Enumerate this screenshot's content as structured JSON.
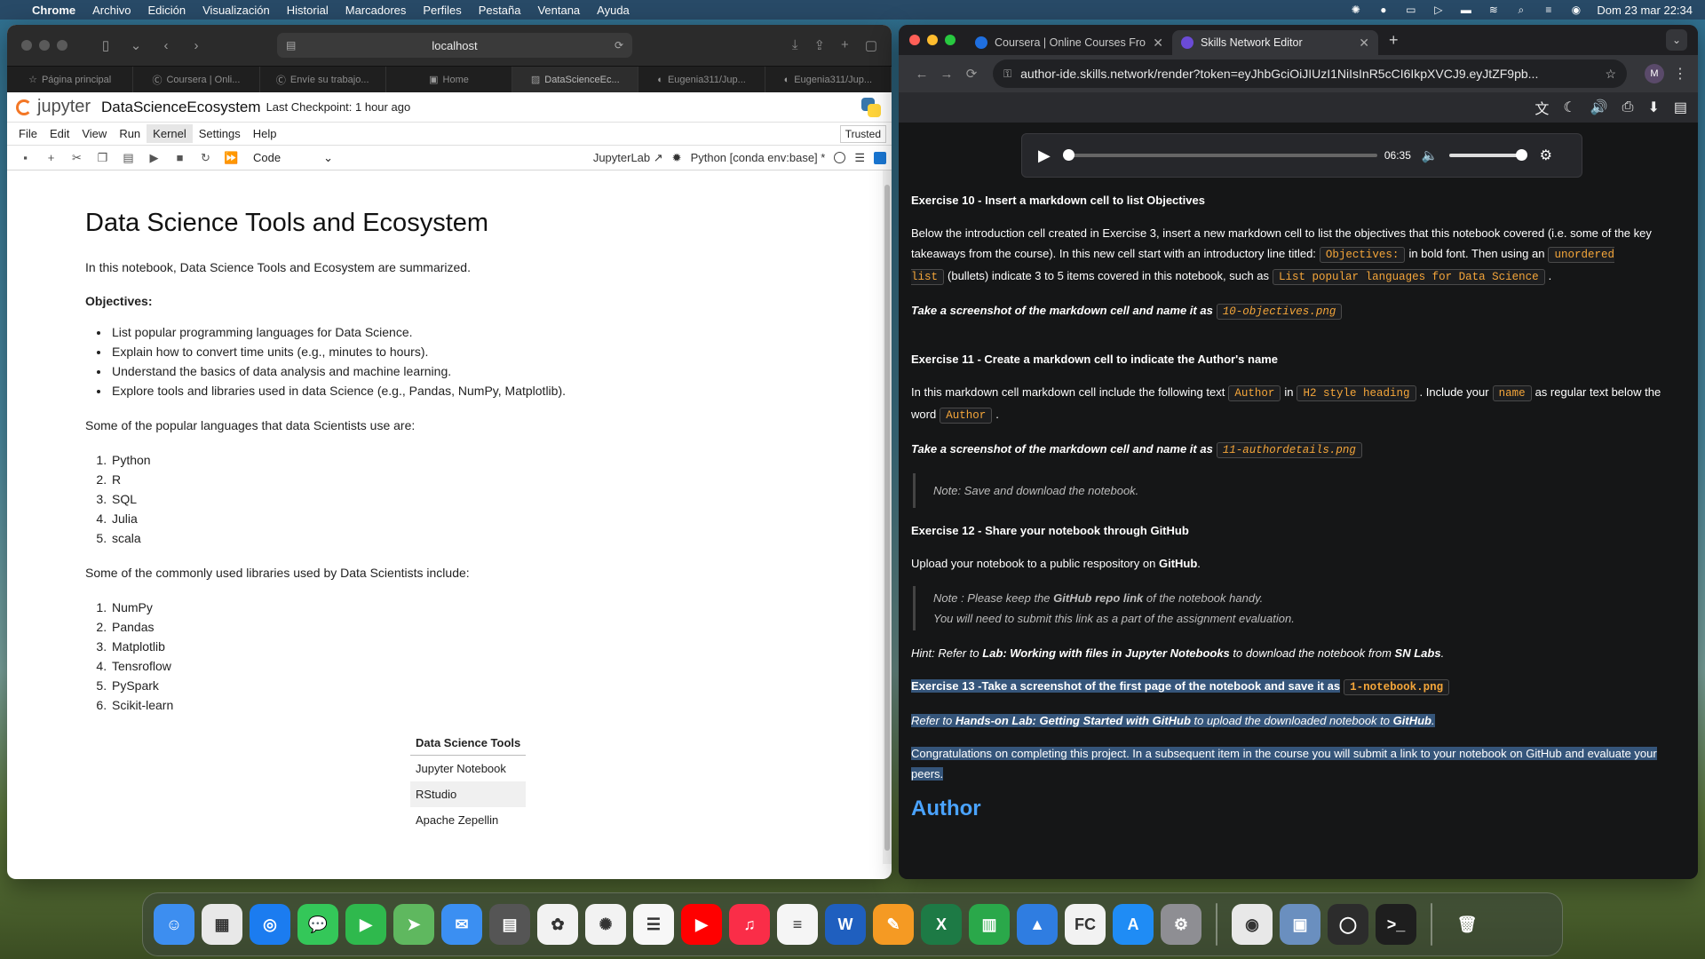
{
  "menubar": {
    "app": "Chrome",
    "items": [
      "Archivo",
      "Edición",
      "Visualización",
      "Historial",
      "Marcadores",
      "Perfiles",
      "Pestaña",
      "Ventana",
      "Ayuda"
    ],
    "clock": "Dom 23 mar 22:34"
  },
  "safari": {
    "address": "localhost",
    "tabs": [
      {
        "label": "Página principal",
        "icon": "star-icon"
      },
      {
        "label": "Coursera | Onli...",
        "icon": "coursera-icon"
      },
      {
        "label": "Envíe su trabajo...",
        "icon": "coursera-icon"
      },
      {
        "label": "Home",
        "icon": "home-icon"
      },
      {
        "label": "DataScienceEc...",
        "icon": "notebook-icon"
      },
      {
        "label": "Eugenia311/Jup...",
        "icon": "github-icon"
      },
      {
        "label": "Eugenia311/Jup...",
        "icon": "github-icon"
      }
    ]
  },
  "jupyter": {
    "logo_text": "jupyter",
    "notebook_name": "DataScienceEcosystem",
    "checkpoint": "Last Checkpoint: 1 hour ago",
    "menu": [
      "File",
      "Edit",
      "View",
      "Run",
      "Kernel",
      "Settings",
      "Help"
    ],
    "active_menu": "Kernel",
    "trusted": "Trusted",
    "cell_type": "Code",
    "jupyterlab_link": "JupyterLab",
    "kernel": "Python [conda env:base] *",
    "notebook": {
      "title": "Data Science Tools and Ecosystem",
      "intro": "In this notebook, Data Science Tools and Ecosystem are summarized.",
      "objectives_label": "Objectives:",
      "objectives": [
        "List popular programming languages for Data Science.",
        "Explain how to convert time units (e.g., minutes to hours).",
        "Understand the basics of data analysis and machine learning.",
        "Explore tools and libraries used in data Science (e.g., Pandas, NumPy, Matplotlib)."
      ],
      "languages_intro": "Some of the popular languages that data Scientists use are:",
      "languages": [
        "Python",
        "R",
        "SQL",
        "Julia",
        "scala"
      ],
      "libraries_intro": "Some of the commonly used libraries used by Data Scientists include:",
      "libraries": [
        "NumPy",
        "Pandas",
        "Matplotlib",
        "Tensroflow",
        "PySpark",
        "Scikit-learn"
      ],
      "table_header": "Data Science Tools",
      "table_rows": [
        "Jupyter Notebook",
        "RStudio",
        "Apache Zepellin"
      ]
    }
  },
  "chrome": {
    "tabs": [
      {
        "label": "Coursera | Online Courses Fro",
        "active": false
      },
      {
        "label": "Skills Network Editor",
        "active": true
      }
    ],
    "url": "author-ide.skills.network/render?token=eyJhbGciOiJIUzI1NiIsInR5cCI6IkpXVCJ9.eyJtZF9pb...",
    "avatar": "M",
    "player_time": "06:35",
    "player_progress": 0.0,
    "player_volume": 1.0,
    "ex10": {
      "heading": "Exercise 10 - Insert a markdown cell to list Objectives",
      "t1": "Below the introduction cell created in Exercise 3, insert a new markdown cell to list the objectives that this notebook covered (i.e. some of the key takeaways from the course). In this new cell start with an introductory line titled:",
      "c1": "Objectives:",
      "t2": "in bold font. Then using an",
      "c2": "unordered list",
      "t3": "(bullets) indicate 3 to 5 items covered in this notebook, such as",
      "c3": "List popular languages for Data Science",
      "t4": ".",
      "shot": "Take a screenshot of the markdown cell and name it as",
      "shot_code": "10-objectives.png"
    },
    "ex11": {
      "heading": "Exercise 11 - Create a markdown cell to indicate the Author's name",
      "t1": "In this markdown cell markdown cell include the following text",
      "c1": "Author",
      "t2": "in",
      "c2": "H2 style heading",
      "t3": ". Include your",
      "c3": "name",
      "t4": "as regular text below the word",
      "c4": "Author",
      "t5": ".",
      "shot": "Take a screenshot of the markdown cell and name it as",
      "shot_code": "11-authordetails.png",
      "note": "Note: Save and download the notebook."
    },
    "ex12": {
      "heading": "Exercise 12 - Share your notebook through GitHub",
      "t1": "Upload your notebook to a public respository on",
      "t1b": "GitHub",
      "t1c": ".",
      "note_a": "Note : Please keep the",
      "note_b": "GitHub repo link",
      "note_c": "of the notebook handy.",
      "note_2": "You will need to submit this link as a part of the assignment evaluation.",
      "hint_a": "Hint: Refer to",
      "hint_b": "Lab: Working with files in Jupyter Notebooks",
      "hint_c": "to download the notebook from",
      "hint_d": "SN Labs",
      "hint_e": "."
    },
    "ex13": {
      "heading": "Exercise 13 -Take a screenshot of the first page of the notebook and save it as",
      "code": "1-notebook.png",
      "ref_a": "Refer to",
      "ref_b": "Hands-on Lab: Getting Started with GitHub",
      "ref_c": "to upload the downloaded notebook to",
      "ref_d": "GitHub",
      "ref_e": ".",
      "congrats": "Congratulations on completing this project. In a subsequent item in the course you will submit a link to your notebook on GitHub and evaluate your peers."
    },
    "author_heading": "Author"
  },
  "dock": {
    "apps": [
      {
        "name": "finder-icon",
        "color": "#3d8ef0",
        "glyph": "☺"
      },
      {
        "name": "launchpad-icon",
        "color": "#e8e8e8",
        "glyph": "▦"
      },
      {
        "name": "safari-icon",
        "color": "#1b7cf0",
        "glyph": "◎"
      },
      {
        "name": "messages-icon",
        "color": "#34c759",
        "glyph": "💬"
      },
      {
        "name": "facetime-icon",
        "color": "#2fb94d",
        "glyph": "▶"
      },
      {
        "name": "maps-icon",
        "color": "#5fb85f",
        "glyph": "➤"
      },
      {
        "name": "mail-icon",
        "color": "#3b8ff2",
        "glyph": "✉"
      },
      {
        "name": "calculator-icon",
        "color": "#555555",
        "glyph": "▤"
      },
      {
        "name": "photos-icon",
        "color": "#f2f2f2",
        "glyph": "✿"
      },
      {
        "name": "chatgpt-icon",
        "color": "#f2f2f2",
        "glyph": "✺"
      },
      {
        "name": "reminders-icon",
        "color": "#f7f7f7",
        "glyph": "☰"
      },
      {
        "name": "youtube-icon",
        "color": "#ff0000",
        "glyph": "▶"
      },
      {
        "name": "music-icon",
        "color": "#fa2d48",
        "glyph": "♫"
      },
      {
        "name": "notes-icon",
        "color": "#f5f5f5",
        "glyph": "≡"
      },
      {
        "name": "word-icon",
        "color": "#1f5fbf",
        "glyph": "W"
      },
      {
        "name": "pages-icon",
        "color": "#f59a23",
        "glyph": "✎"
      },
      {
        "name": "excel-icon",
        "color": "#1d7a45",
        "glyph": "X"
      },
      {
        "name": "numbers-icon",
        "color": "#2aa84a",
        "glyph": "▥"
      },
      {
        "name": "keynote-icon",
        "color": "#2f7de1",
        "glyph": "▲"
      },
      {
        "name": "fc-icon",
        "color": "#f2f2f2",
        "glyph": "FC"
      },
      {
        "name": "app-store-icon",
        "color": "#1f8cf5",
        "glyph": "A"
      },
      {
        "name": "system-settings-icon",
        "color": "#8e8e93",
        "glyph": "⚙"
      },
      {
        "name": "chrome-icon",
        "color": "#e8e8e8",
        "glyph": "◉"
      },
      {
        "name": "preview-icon",
        "color": "#6a8fbf",
        "glyph": "▣"
      },
      {
        "name": "activity-icon",
        "color": "#2c2c2c",
        "glyph": "◯"
      },
      {
        "name": "terminal-icon",
        "color": "#1e1e1e",
        "glyph": ">_"
      }
    ],
    "trash": {
      "name": "trash-icon",
      "glyph": "🗑"
    }
  }
}
